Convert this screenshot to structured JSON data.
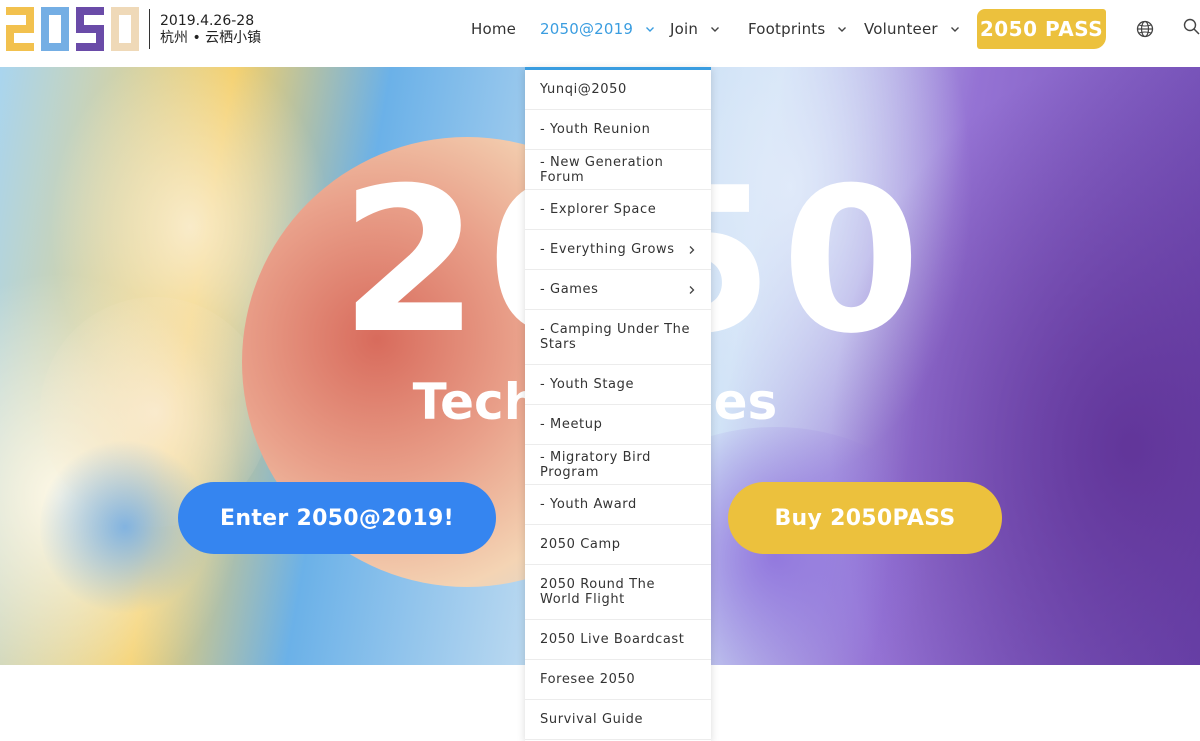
{
  "header": {
    "logo_text": "2050",
    "event_date": "2019.4.26-28",
    "event_place": "杭州 • 云栖小镇",
    "nav": [
      {
        "label": "Home",
        "has_dropdown": false
      },
      {
        "label": "2050@2019",
        "has_dropdown": true,
        "active": true
      },
      {
        "label": "Join",
        "has_dropdown": true
      },
      {
        "label": "Footprints",
        "has_dropdown": true
      },
      {
        "label": "Volunteer",
        "has_dropdown": true
      }
    ],
    "pass_button": "2050 PASS",
    "icons": [
      "globe-icon",
      "search-icon"
    ]
  },
  "hero": {
    "title": "2050",
    "subtitle": "Technologies",
    "enter_button": "Enter 2050@2019!",
    "buy_button": "Buy 2050PASS"
  },
  "dropdown": {
    "items": [
      {
        "label": "Yunqi@2050",
        "submenu": false
      },
      {
        "label": "- Youth Reunion",
        "submenu": false
      },
      {
        "label": "- New Generation Forum",
        "submenu": false
      },
      {
        "label": "- Explorer Space",
        "submenu": false
      },
      {
        "label": "- Everything Grows",
        "submenu": true
      },
      {
        "label": "- Games",
        "submenu": true
      },
      {
        "label": "- Camping Under The Stars",
        "submenu": false
      },
      {
        "label": "- Youth Stage",
        "submenu": false
      },
      {
        "label": "- Meetup",
        "submenu": false
      },
      {
        "label": "- Migratory Bird Program",
        "submenu": false
      },
      {
        "label": "- Youth Award",
        "submenu": false
      },
      {
        "label": "2050 Camp",
        "submenu": false
      },
      {
        "label": "2050 Round The World Flight",
        "submenu": false
      },
      {
        "label": "2050 Live Boardcast",
        "submenu": false
      },
      {
        "label": "Foresee 2050",
        "submenu": false
      },
      {
        "label": "Survival Guide",
        "submenu": false
      }
    ]
  },
  "colors": {
    "accent_blue": "#3a9de0",
    "button_blue": "#3585f0",
    "pass_yellow": "#ecc13d",
    "logo_yellow": "#f2c14e",
    "logo_blue": "#74aee4",
    "logo_purple": "#6a4ba8",
    "logo_cream": "#efd9b8"
  }
}
